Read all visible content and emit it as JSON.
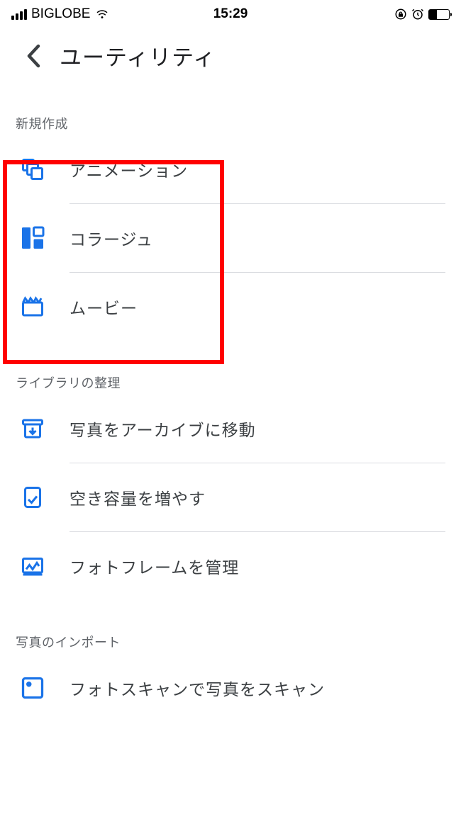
{
  "status": {
    "carrier": "BIGLOBE",
    "time": "15:29"
  },
  "header": {
    "title": "ユーティリティ"
  },
  "sections": {
    "create": {
      "label": "新規作成",
      "items": [
        {
          "label": "アニメーション"
        },
        {
          "label": "コラージュ"
        },
        {
          "label": "ムービー"
        }
      ]
    },
    "organize": {
      "label": "ライブラリの整理",
      "items": [
        {
          "label": "写真をアーカイブに移動"
        },
        {
          "label": "空き容量を増やす"
        },
        {
          "label": "フォトフレームを管理"
        }
      ]
    },
    "import": {
      "label": "写真のインポート",
      "items": [
        {
          "label": "フォトスキャンで写真をスキャン"
        }
      ]
    }
  },
  "colors": {
    "accent": "#1a73e8",
    "highlight": "#ff0000"
  }
}
